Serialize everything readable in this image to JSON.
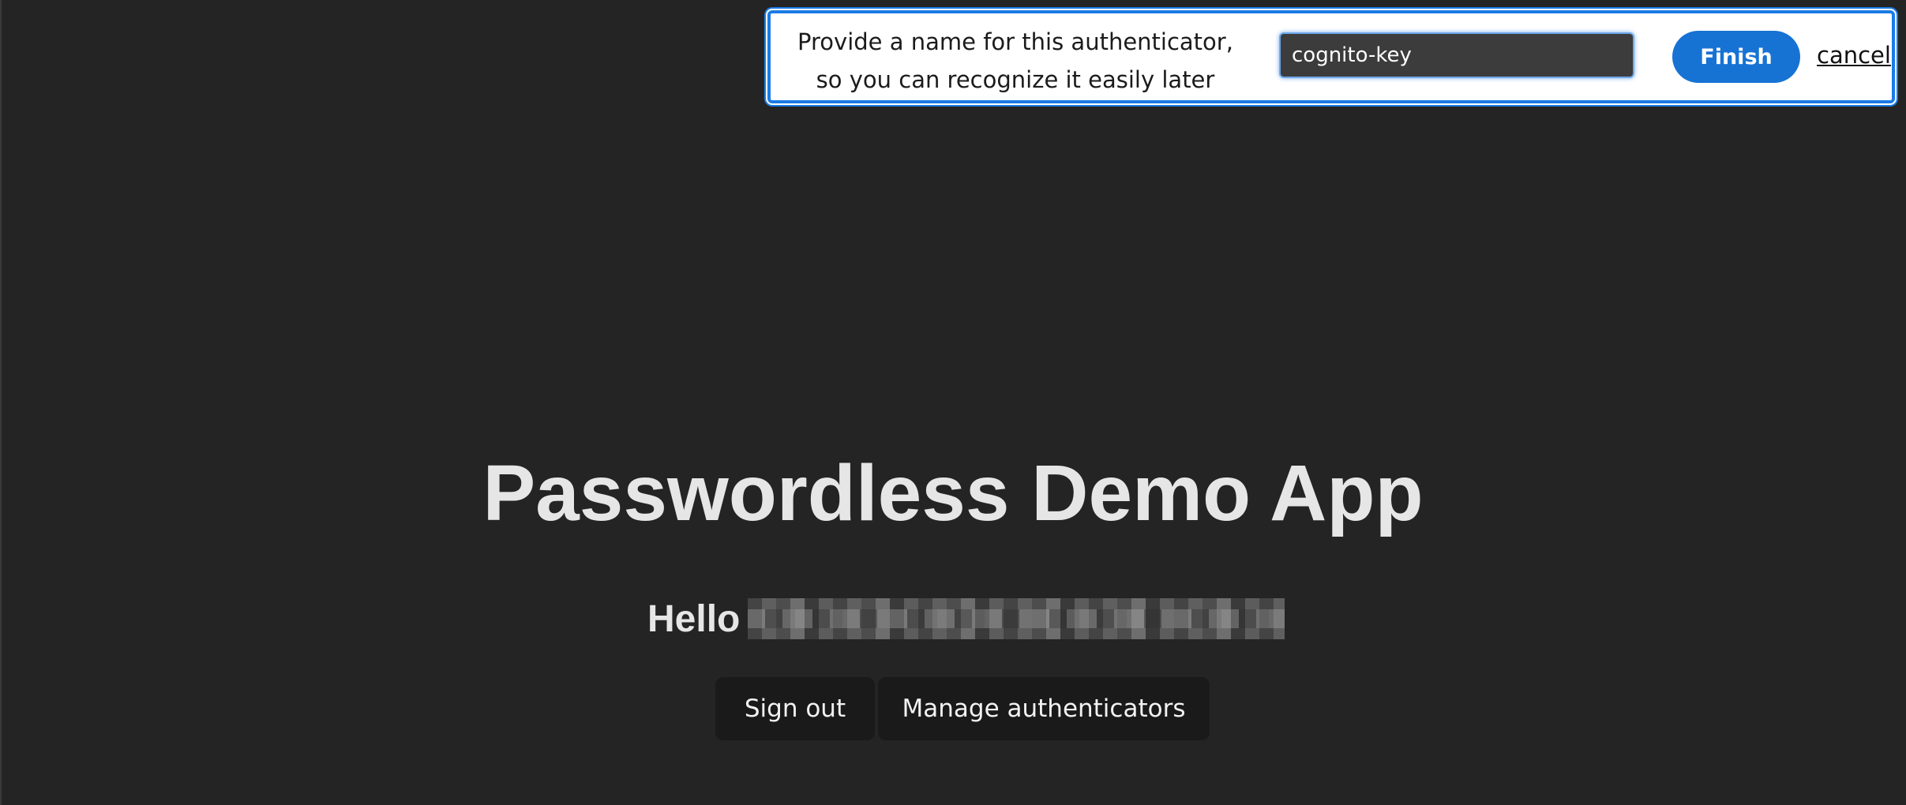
{
  "dialog": {
    "prompt": "Provide a name for this authenticator, so you can recognize it easily later",
    "input_value": "cognito-key",
    "finish_label": "Finish",
    "cancel_label": "cancel"
  },
  "main": {
    "title": "Passwordless Demo App",
    "greeting": "Hello",
    "buttons": {
      "sign_out": "Sign out",
      "manage": "Manage authenticators"
    }
  },
  "colors": {
    "background": "#242424",
    "accent": "#1673d4",
    "dialog_border": "#1a7be6"
  }
}
